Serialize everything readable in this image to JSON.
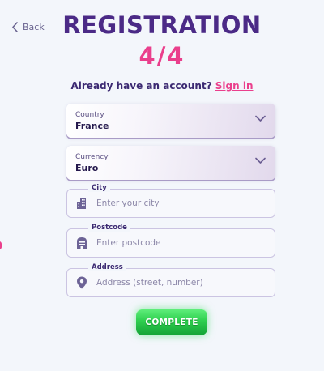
{
  "header": {
    "back_label": "Back",
    "title": "REGISTRATION",
    "step": "4/4"
  },
  "account_prompt": {
    "text": "Already have an account?",
    "link": "Sign in"
  },
  "form": {
    "country": {
      "label": "Country",
      "value": "France"
    },
    "currency": {
      "label": "Currency",
      "value": "Euro"
    },
    "city": {
      "label": "City",
      "placeholder": "Enter your city"
    },
    "postcode": {
      "label": "Postcode",
      "placeholder": "Enter postcode"
    },
    "address": {
      "label": "Address",
      "placeholder": "Address (street, number)"
    },
    "submit_label": "COMPLETE"
  },
  "colors": {
    "title": "#4b2a86",
    "accent_pink": "#ea3f8c",
    "button_green": "#2fcf4f"
  },
  "icons": {
    "back": "chevron-left-icon",
    "dropdown": "chevron-down-icon",
    "city": "building-icon",
    "postcode": "mailbox-icon",
    "address": "location-pin-icon"
  }
}
